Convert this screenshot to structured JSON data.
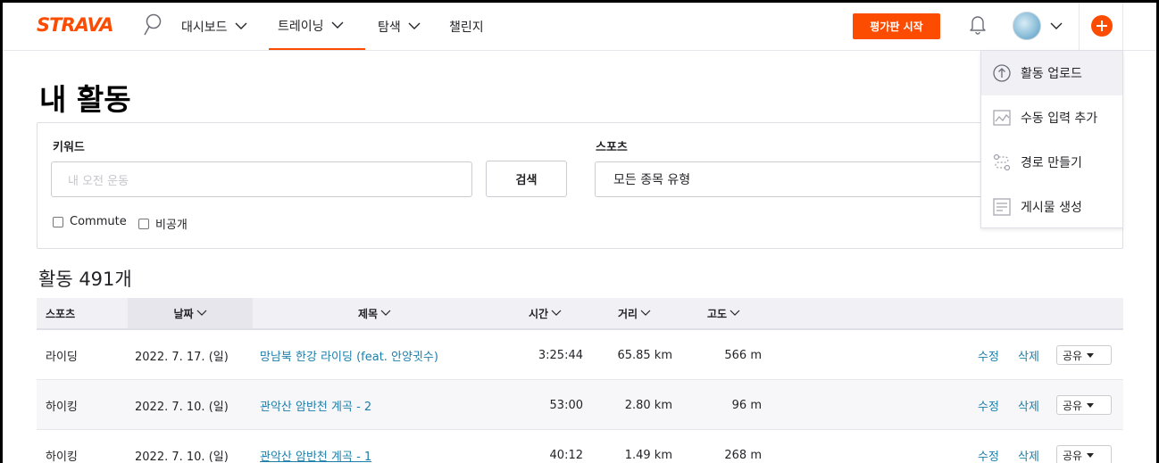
{
  "nav": {
    "logo": "STRAVA",
    "items": [
      {
        "label": "대시보드",
        "has_chevron": true
      },
      {
        "label": "트레이닝",
        "has_chevron": true,
        "active": true
      },
      {
        "label": "탐색",
        "has_chevron": true
      },
      {
        "label": "챌린지",
        "has_chevron": false
      }
    ],
    "trial_button": "평가판 시작",
    "accent": "#fc4c02"
  },
  "dropdown": {
    "items": [
      {
        "label": "활동 업로드",
        "icon": "upload-icon"
      },
      {
        "label": "수동 입력 추가",
        "icon": "manual-entry-icon"
      },
      {
        "label": "경로 만들기",
        "icon": "route-icon"
      },
      {
        "label": "게시물 생성",
        "icon": "post-icon"
      }
    ]
  },
  "page": {
    "title": "내 활동"
  },
  "filters": {
    "keyword_label": "키워드",
    "keyword_placeholder": "내 오전 운동",
    "search_button": "검색",
    "sport_label": "스포츠",
    "sport_value": "모든 종목 유형",
    "checkboxes": [
      {
        "label": "Commute",
        "checked": false
      },
      {
        "label": "비공개",
        "checked": false
      }
    ]
  },
  "activity_count": "활동 491개",
  "table": {
    "headers": [
      "스포츠",
      "날짜",
      "제목",
      "시간",
      "거리",
      "고도"
    ],
    "edit_label": "수정",
    "delete_label": "삭제",
    "share_label": "공유",
    "rows": [
      {
        "sport": "라이딩",
        "date": "2022. 7. 17. (일)",
        "title": "망남북 한강 라이딩 (feat. 안양귓수)",
        "time": "3:25:44",
        "distance": "65.85 km",
        "elevation": "566 m"
      },
      {
        "sport": "하이킹",
        "date": "2022. 7. 10. (일)",
        "title": "관악산 암반천 계곡 - 2",
        "time": "53:00",
        "distance": "2.80 km",
        "elevation": "96 m"
      },
      {
        "sport": "하이킹",
        "date": "2022. 7. 10. (일)",
        "title": "관악산 암반천 계곡 - 1",
        "time": "40:12",
        "distance": "1.49 km",
        "elevation": "268 m"
      }
    ]
  }
}
